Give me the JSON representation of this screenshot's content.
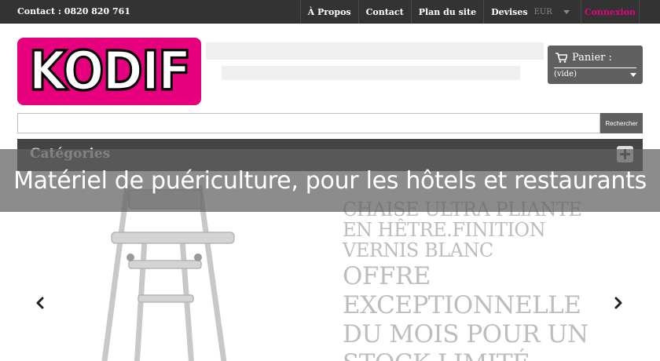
{
  "topbar": {
    "contact": "Contact : 0820 820 761",
    "nav": [
      "À Propos",
      "Contact",
      "Plan du site"
    ],
    "devises_label": "Devises",
    "devises_value": "EUR",
    "login": "Connexion"
  },
  "header": {
    "logo_text": "KODIF",
    "cart_label": "Panier :",
    "cart_status": "(vide)"
  },
  "search": {
    "placeholder": "",
    "button": "Rechercher"
  },
  "categories": {
    "title": "Catégories"
  },
  "slider": {
    "headline": "CHAISE ULTRA PLIANTE EN HÊTRE.FINITION VERNIS BLANC",
    "headline_lines": [
      "CHAISE ULTRA PLIANTE",
      "EN HÊTRE.FINITION",
      "VERNIS BLANC"
    ],
    "offer_lines": [
      "OFFRE",
      "EXCEPTIONNELLE",
      "DU MOIS POUR UN",
      "STOCK LIMITÉ"
    ]
  },
  "caption": "Matériel de puériculture, pour les hôtels et restaurants",
  "colors": {
    "brand_pink": "#e6007e",
    "topbar": "#333333",
    "dark_grey": "#444444"
  },
  "icons": {
    "cart": "cart-icon",
    "prev": "chevron-left-icon",
    "next": "chevron-right-icon",
    "expand": "plus-icon"
  }
}
